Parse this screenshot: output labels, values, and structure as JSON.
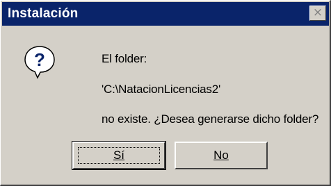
{
  "window": {
    "title": "Instalación",
    "close_glyph": "×"
  },
  "icon": {
    "name": "question-icon",
    "glyph": "?",
    "color": "#0a246a"
  },
  "message": {
    "line1": "El folder:",
    "line2": "'C:\\NatacionLicencias2'",
    "line3": "no existe. ¿Desea generarse dicho folder?"
  },
  "buttons": {
    "yes_label": "Sí",
    "no_label": "No"
  },
  "colors": {
    "titlebar": "#0a246a",
    "face": "#d4d0c8"
  }
}
